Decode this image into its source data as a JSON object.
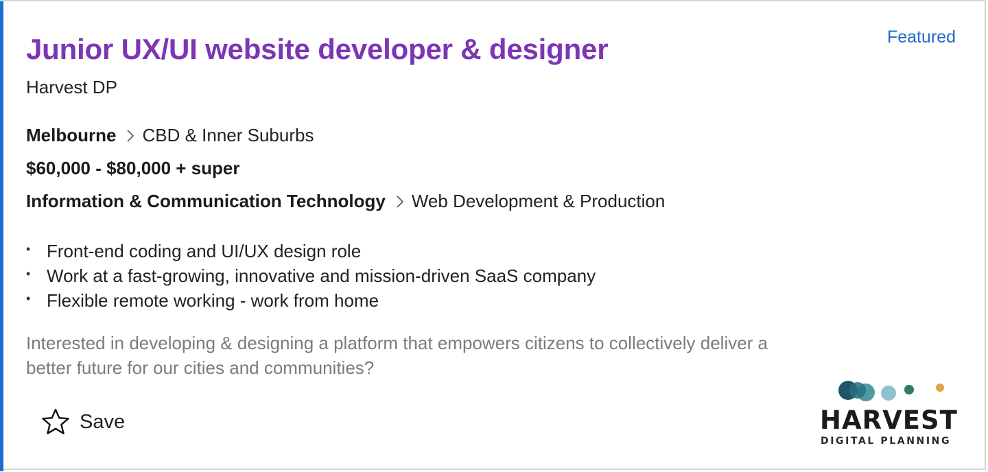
{
  "job": {
    "title": "Junior UX/UI website developer & designer",
    "company": "Harvest DP",
    "featured_label": "Featured",
    "location": {
      "city": "Melbourne",
      "area": "CBD & Inner Suburbs"
    },
    "salary": "$60,000 - $80,000 + super",
    "classification": {
      "category": "Information & Communication Technology",
      "subcategory": "Web Development & Production"
    },
    "bullets": [
      "Front-end coding and UI/UX design role",
      "Work at a fast-growing, innovative and mission-driven SaaS company",
      "Flexible remote working - work from home"
    ],
    "description": "Interested in developing & designing a platform that empowers citizens to collectively deliver a better future for our cities and communities?",
    "save_label": "Save"
  },
  "logo": {
    "wordmark": "HARVEST",
    "tagline": "DIGITAL PLANNING"
  },
  "colors": {
    "title": "#7b36b5",
    "featured": "#2268c5",
    "accent_bar": "#1c6fd1",
    "description": "#7b7b7b",
    "logo_dark_teal": "#1f5566",
    "logo_mid_teal": "#3f8f9c",
    "logo_light_teal": "#8fc4cc",
    "logo_green": "#2e7a63",
    "logo_orange": "#e5a24a"
  },
  "icons": {
    "save": "star-outline-icon",
    "separator": "chevron-right-icon"
  }
}
